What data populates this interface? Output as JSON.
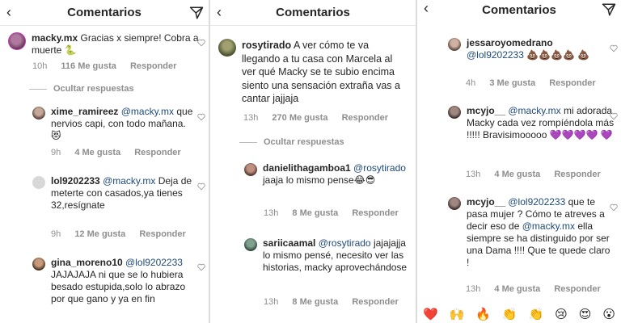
{
  "panel1": {
    "title": "Comentarios",
    "main": {
      "user": "macky.mx",
      "text": "Gracias x siempre! Cobra a muerte 🐍",
      "time": "10h",
      "likes": "116 Me gusta",
      "reply": "Responder"
    },
    "hide_replies": "Ocultar respuestas",
    "replies": [
      {
        "user": "xime_ramireez",
        "mention": "@macky.mx",
        "text": "que nervios capi, con todo mañana. 😻",
        "time": "9h",
        "likes": "4 Me gusta",
        "reply": "Responder"
      },
      {
        "user": "lol9202233",
        "mention": "@macky.mx",
        "text": "Deja de meterte con casados,ya tienes 32,resígnate",
        "time": "9h",
        "likes": "12 Me gusta",
        "reply": "Responder"
      },
      {
        "user": "gina_moreno10",
        "mention": "@lol9202233",
        "text": "JAJAJAJA ni que se lo hubiera besado estupida,solo lo abrazo por que gano y ya en fin"
      }
    ]
  },
  "panel2": {
    "title": "Comentarios",
    "main": {
      "user": "rosytirado",
      "text": "A ver cómo te va llegando a tu casa con Marcela al ver qué Macky se te subio encima siento una sensación extraña vas a cantar jajjaja",
      "time": "13h",
      "likes": "270 Me gusta",
      "reply": "Responder"
    },
    "hide_replies": "Ocultar respuestas",
    "replies": [
      {
        "user": "danielithagamboa1",
        "mention": "@rosytirado",
        "text": "jaaja lo mismo pense😂😎",
        "time": "13h",
        "likes": "8 Me gusta",
        "reply": "Responder"
      },
      {
        "user": "sariicaamal",
        "mention": "@rosytirado",
        "text": "jajajajja lo mismo pensé, necesito ver las historias, macky aprovechándose",
        "time": "13h",
        "likes": "8 Me gusta",
        "reply": "Responder"
      }
    ]
  },
  "panel3": {
    "title": "Comentarios",
    "replies": [
      {
        "user": "jessaroyomedrano",
        "mention": "@lol9202233",
        "text": "💩💩💩💩 💩",
        "time": "4h",
        "likes": "3 Me gusta",
        "reply": "Responder"
      },
      {
        "user": "mcyjo__",
        "mention": "@macky.mx",
        "text": "mi adorada Macky cada vez rompíéndola más !!!!! Bravisimooooo 💜💜💜💜 💜",
        "time": "13h",
        "likes": "4 Me gusta",
        "reply": "Responder"
      },
      {
        "user": "mcyjo__",
        "mention": "@lol9202233",
        "text": "que te pasa mujer ? Cómo te atreves a decir eso de",
        "mention2": "@macky.mx",
        "text2": "ella siempre se ha distinguido por ser una Dama !!!! Que te quede claro !",
        "time": "13h",
        "likes": "4 Me gusta",
        "reply": "Responder"
      }
    ],
    "emojis": [
      "❤️",
      "🙌",
      "🔥",
      "👏",
      "👏",
      "😢",
      "😍",
      "😮"
    ]
  },
  "colors": {
    "mention": "#1e4a7a",
    "meta": "#8e8e8e",
    "text": "#262626"
  }
}
